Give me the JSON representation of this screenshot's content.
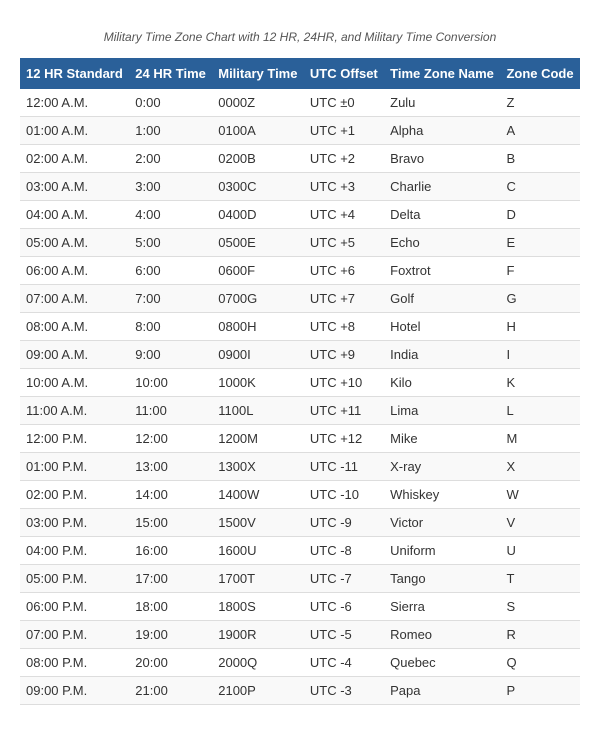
{
  "subtitle": "Military Time Zone Chart with 12 HR, 24HR, and Military Time Conversion",
  "table": {
    "headers": [
      "12 HR Standard",
      "24 HR Time",
      "Military Time",
      "UTC Offset",
      "Time Zone Name",
      "Zone Code"
    ],
    "rows": [
      [
        "12:00 A.M.",
        "0:00",
        "0000Z",
        "UTC ±0",
        "Zulu",
        "Z"
      ],
      [
        "01:00 A.M.",
        "1:00",
        "0100A",
        "UTC +1",
        "Alpha",
        "A"
      ],
      [
        "02:00 A.M.",
        "2:00",
        "0200B",
        "UTC +2",
        "Bravo",
        "B"
      ],
      [
        "03:00 A.M.",
        "3:00",
        "0300C",
        "UTC +3",
        "Charlie",
        "C"
      ],
      [
        "04:00 A.M.",
        "4:00",
        "0400D",
        "UTC +4",
        "Delta",
        "D"
      ],
      [
        "05:00 A.M.",
        "5:00",
        "0500E",
        "UTC +5",
        "Echo",
        "E"
      ],
      [
        "06:00 A.M.",
        "6:00",
        "0600F",
        "UTC +6",
        "Foxtrot",
        "F"
      ],
      [
        "07:00 A.M.",
        "7:00",
        "0700G",
        "UTC +7",
        "Golf",
        "G"
      ],
      [
        "08:00 A.M.",
        "8:00",
        "0800H",
        "UTC +8",
        "Hotel",
        "H"
      ],
      [
        "09:00 A.M.",
        "9:00",
        "0900I",
        "UTC +9",
        "India",
        "I"
      ],
      [
        "10:00 A.M.",
        "10:00",
        "1000K",
        "UTC +10",
        "Kilo",
        "K"
      ],
      [
        "11:00 A.M.",
        "11:00",
        "1100L",
        "UTC +11",
        "Lima",
        "L"
      ],
      [
        "12:00 P.M.",
        "12:00",
        "1200M",
        "UTC +12",
        "Mike",
        "M"
      ],
      [
        "01:00 P.M.",
        "13:00",
        "1300X",
        "UTC -11",
        "X-ray",
        "X"
      ],
      [
        "02:00 P.M.",
        "14:00",
        "1400W",
        "UTC -10",
        "Whiskey",
        "W"
      ],
      [
        "03:00 P.M.",
        "15:00",
        "1500V",
        "UTC -9",
        "Victor",
        "V"
      ],
      [
        "04:00 P.M.",
        "16:00",
        "1600U",
        "UTC -8",
        "Uniform",
        "U"
      ],
      [
        "05:00 P.M.",
        "17:00",
        "1700T",
        "UTC -7",
        "Tango",
        "T"
      ],
      [
        "06:00 P.M.",
        "18:00",
        "1800S",
        "UTC -6",
        "Sierra",
        "S"
      ],
      [
        "07:00 P.M.",
        "19:00",
        "1900R",
        "UTC -5",
        "Romeo",
        "R"
      ],
      [
        "08:00 P.M.",
        "20:00",
        "2000Q",
        "UTC -4",
        "Quebec",
        "Q"
      ],
      [
        "09:00 P.M.",
        "21:00",
        "2100P",
        "UTC -3",
        "Papa",
        "P"
      ]
    ]
  }
}
